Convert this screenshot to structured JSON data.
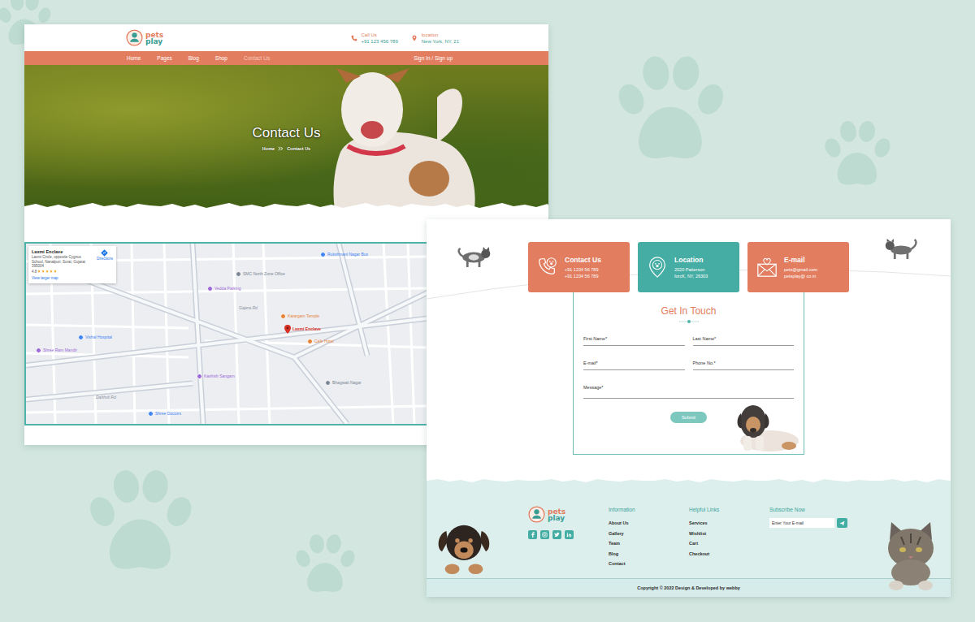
{
  "left_page": {
    "logo": {
      "top": "pets",
      "bottom": "play"
    },
    "header_contacts": [
      {
        "label": "Call Us",
        "value": "+91 123 456 789"
      },
      {
        "label": "location",
        "value": "New York, NY, 21"
      }
    ],
    "nav": [
      {
        "label": "Home",
        "selected": false
      },
      {
        "label": "Pages",
        "selected": false
      },
      {
        "label": "Blog",
        "selected": false
      },
      {
        "label": "Shop",
        "selected": false
      },
      {
        "label": "Contact Us",
        "selected": true
      }
    ],
    "auth_link": "Sign In / Sign up",
    "hero": {
      "title": "Contact Us",
      "breadcrumb": [
        {
          "label": "Home"
        },
        {
          "label": "Contact Us"
        }
      ]
    },
    "map": {
      "card": {
        "name": "Laxmi Enclave",
        "address": "Laxmi Circle, opposite Cygnus School, Nanalpuri, Surat, Gujarat 395004",
        "rating": "4.8",
        "stars": 5,
        "link": "View larger map",
        "directions": "Directions"
      },
      "labels": [
        {
          "text": "Rukshmani Nagar Bus",
          "kind": "place",
          "color": "#4285f4"
        },
        {
          "text": "SMC North Zone Office",
          "kind": "place",
          "color": "#7b8794"
        },
        {
          "text": "Vedda Parking",
          "kind": "place",
          "color": "#9c6ad6"
        },
        {
          "text": "Gajera Rd",
          "kind": "road",
          "color": "#8a929c"
        },
        {
          "text": "Katargam Temple",
          "kind": "place",
          "color": "#e8833a"
        },
        {
          "text": "Laxmi Enclave",
          "kind": "pin",
          "color": "#d93025"
        },
        {
          "text": "Cafe Hotel",
          "kind": "place",
          "color": "#e8833a"
        },
        {
          "text": "Vishal Hospital",
          "kind": "place",
          "color": "#4285f4"
        },
        {
          "text": "Shree Ram Mandir",
          "kind": "place",
          "color": "#9c6ad6"
        },
        {
          "text": "Kashish Sangam",
          "kind": "place",
          "color": "#9c6ad6"
        },
        {
          "text": "Bhagwati Nagar",
          "kind": "place",
          "color": "#7b8794"
        },
        {
          "text": "Dabholi Rd",
          "kind": "road",
          "color": "#8a929c"
        },
        {
          "text": "Shree Doctors",
          "kind": "place",
          "color": "#4285f4"
        }
      ]
    }
  },
  "right_page": {
    "info_cards": [
      {
        "title": "Contact Us",
        "lines": [
          "+91 1234 56 789",
          "+91 1234 56 789"
        ],
        "color": "#e27d60"
      },
      {
        "title": "Location",
        "lines": [
          "2020 Patterson",
          "forcK, NY, 26303"
        ],
        "color": "#45ada3"
      },
      {
        "title": "E-mail",
        "lines": [
          "pets@gmail.com",
          "petsplay@ co.in"
        ],
        "color": "#e27d60"
      }
    ],
    "form": {
      "title": "Get In Touch",
      "fields": [
        {
          "label": "First Name*",
          "kind": "input"
        },
        {
          "label": "Last Name*",
          "kind": "input"
        },
        {
          "label": "E-mail*",
          "kind": "input"
        },
        {
          "label": "Phone No.*",
          "kind": "input"
        },
        {
          "label": "Message*",
          "kind": "textarea"
        }
      ],
      "submit": "Submit"
    },
    "footer": {
      "logo": {
        "top": "pets",
        "bottom": "play"
      },
      "columns": [
        {
          "title": "Information",
          "links": [
            "About Us",
            "Gallery",
            "Team",
            "Blog",
            "Contact"
          ]
        },
        {
          "title": "Helpful Links",
          "links": [
            "Services",
            "Wishlist",
            "Cart",
            "Checkout"
          ]
        }
      ],
      "subscribe": {
        "title": "Subscribe Now",
        "placeholder": "Enter Your E-mail"
      },
      "copyright": "Copyright © 2022 Design & Developed by webby"
    }
  }
}
